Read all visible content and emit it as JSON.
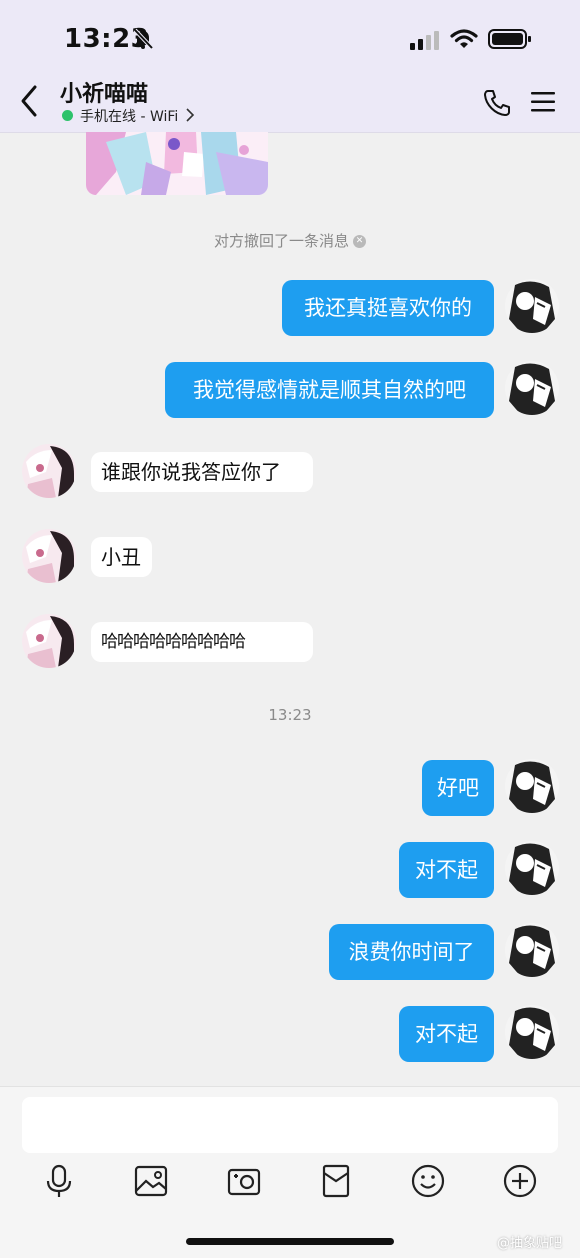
{
  "status_bar": {
    "time": "13:23"
  },
  "header": {
    "contact_name": "小祈喵喵",
    "status": "手机在线 - WiFi"
  },
  "messages": {
    "system_recall": "对方撤回了一条消息",
    "out_1": "我还真挺喜欢你的",
    "out_2": "我觉得感情就是顺其自然的吧",
    "in_1": "谁跟你说我答应你了",
    "in_2": "小丑",
    "in_3": "哈哈哈哈哈哈哈哈哈",
    "time_divider": "13:23",
    "out_3": "好吧",
    "out_4": "对不起",
    "out_5": "浪费你时间了",
    "out_6": "对不起"
  },
  "toolbar": {
    "icons": [
      "microphone-icon",
      "image-icon",
      "camera-icon",
      "red-packet-icon",
      "emoji-icon",
      "plus-icon"
    ]
  },
  "watermark": "@抽象贴吧",
  "colors": {
    "bubble_out": "#1e9ef0",
    "bubble_in": "#ffffff",
    "online": "#2dc26b",
    "header_bg": "#ece9f7"
  }
}
